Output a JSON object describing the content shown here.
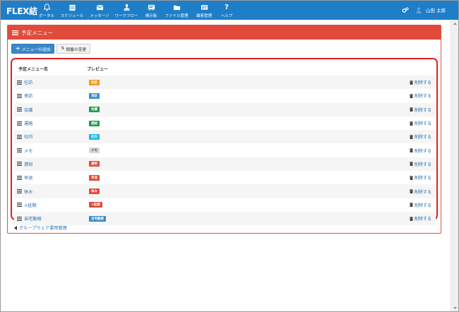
{
  "app": {
    "logo": "FLEX結"
  },
  "nav": [
    {
      "label": "ポータル",
      "icon": "bell-icon"
    },
    {
      "label": "スケジュール",
      "icon": "calendar-icon"
    },
    {
      "label": "メッセージ",
      "icon": "envelope-icon"
    },
    {
      "label": "ワークフロー",
      "icon": "stamp-icon"
    },
    {
      "label": "掲示板",
      "icon": "board-icon"
    },
    {
      "label": "ファイル管理",
      "icon": "folder-icon"
    },
    {
      "label": "顧客管理",
      "icon": "card-icon"
    },
    {
      "label": "ヘルプ",
      "icon": "question-icon"
    }
  ],
  "user": {
    "name": "山田 太郎"
  },
  "panel": {
    "title": "予定メニュー",
    "add_label": "メニューの追加",
    "sort_label": "順番の変更"
  },
  "table": {
    "col_name": "予定メニュー名",
    "col_preview": "プレビュー",
    "delete_label": "削除する",
    "rows": [
      {
        "name": "往訪",
        "badge": "往訪",
        "color": "#ef9a1f"
      },
      {
        "name": "来訪",
        "badge": "来訪",
        "color": "#3a8ac4"
      },
      {
        "name": "会議",
        "badge": "会議",
        "color": "#1e9b48"
      },
      {
        "name": "運絡",
        "badge": "連絡",
        "color": "#1e9b48"
      },
      {
        "name": "社内",
        "badge": "社内",
        "color": "#1fb6dc"
      },
      {
        "name": "メモ",
        "badge": "メモ",
        "color": "#d8d8d8"
      },
      {
        "name": "遅刻",
        "badge": "遅刻",
        "color": "#dd4a3a"
      },
      {
        "name": "早退",
        "badge": "早退",
        "color": "#dd4a3a"
      },
      {
        "name": "休み",
        "badge": "休み",
        "color": "#dd4a3a"
      },
      {
        "name": "×延期",
        "badge": "×延期",
        "color": "#dd4a3a"
      },
      {
        "name": "自宅勤務",
        "badge": "自宅勤務",
        "color": "#3a8ac4"
      }
    ]
  },
  "backlink": "グループウェア運用管理"
}
